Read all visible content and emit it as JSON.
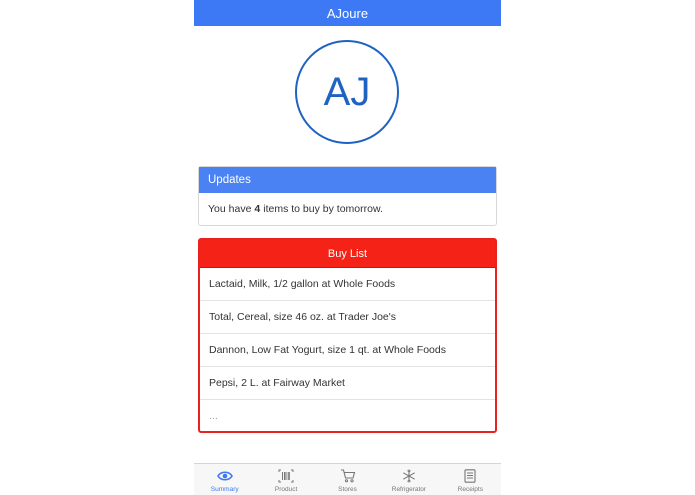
{
  "app": {
    "title": "AJoure"
  },
  "avatar": {
    "initials": "AJ"
  },
  "updates": {
    "header": "Updates",
    "text_before": "You have",
    "count": "4",
    "text_after": "items to buy by tomorrow."
  },
  "buy_list": {
    "header": "Buy List",
    "items": [
      "Lactaid, Milk, 1/2 gallon at Whole Foods",
      "Total, Cereal, size 46 oz. at Trader Joe's",
      "Dannon, Low Fat Yogurt, size 1 qt. at Whole Foods",
      "Pepsi, 2 L. at Fairway Market",
      "..."
    ]
  },
  "tabs": [
    {
      "label": "Summary",
      "icon": "eye-icon",
      "active": true
    },
    {
      "label": "Product",
      "icon": "barcode-icon",
      "active": false
    },
    {
      "label": "Stores",
      "icon": "cart-icon",
      "active": false
    },
    {
      "label": "Refrigerator",
      "icon": "snowflake-icon",
      "active": false
    },
    {
      "label": "Receipts",
      "icon": "receipt-icon",
      "active": false
    }
  ],
  "colors": {
    "primary": "#3d78f5",
    "danger": "#f52218",
    "avatar": "#1f63c2"
  }
}
